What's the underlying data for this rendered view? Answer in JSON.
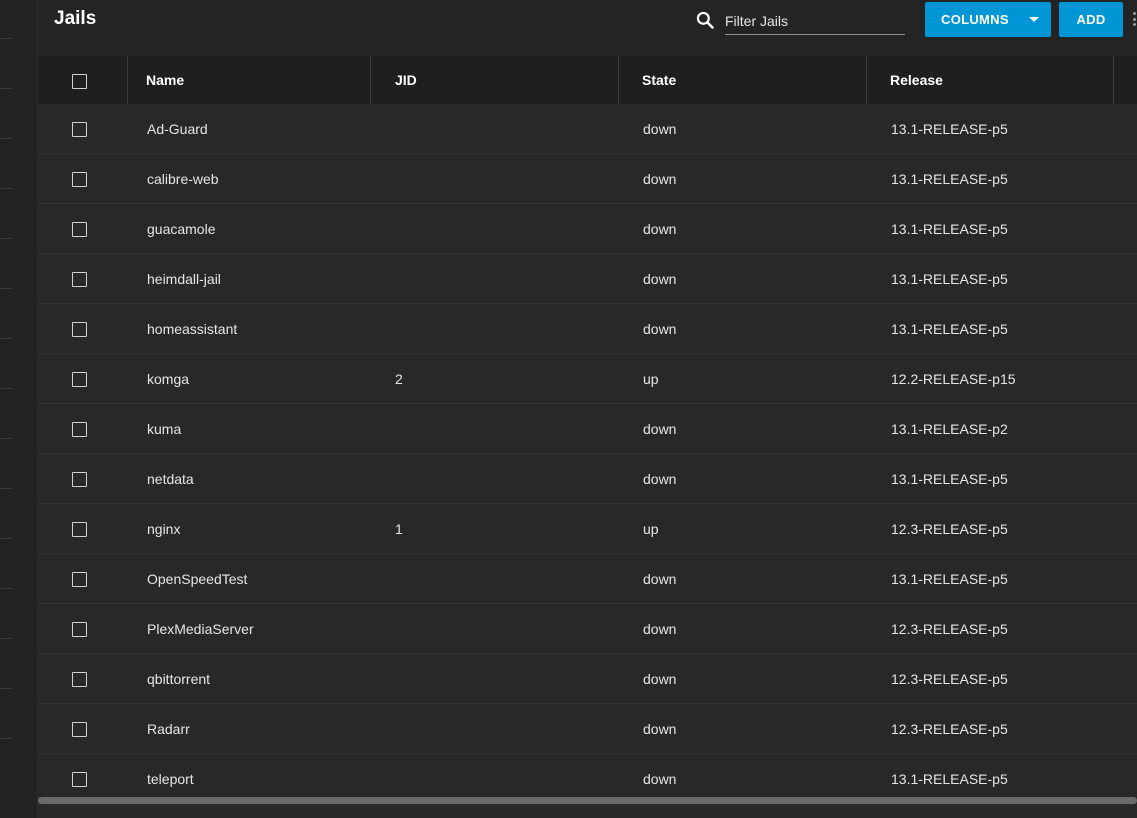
{
  "header": {
    "title": "Jails",
    "search_placeholder": "Filter Jails",
    "search_value": "",
    "columns_label": "COLUMNS",
    "add_label": "ADD"
  },
  "table": {
    "columns": [
      "Name",
      "JID",
      "State",
      "Release"
    ],
    "rows": [
      {
        "name": "Ad-Guard",
        "jid": "",
        "state": "down",
        "release": "13.1-RELEASE-p5"
      },
      {
        "name": "calibre-web",
        "jid": "",
        "state": "down",
        "release": "13.1-RELEASE-p5"
      },
      {
        "name": "guacamole",
        "jid": "",
        "state": "down",
        "release": "13.1-RELEASE-p5"
      },
      {
        "name": "heimdall-jail",
        "jid": "",
        "state": "down",
        "release": "13.1-RELEASE-p5"
      },
      {
        "name": "homeassistant",
        "jid": "",
        "state": "down",
        "release": "13.1-RELEASE-p5"
      },
      {
        "name": "komga",
        "jid": "2",
        "state": "up",
        "release": "12.2-RELEASE-p15"
      },
      {
        "name": "kuma",
        "jid": "",
        "state": "down",
        "release": "13.1-RELEASE-p2"
      },
      {
        "name": "netdata",
        "jid": "",
        "state": "down",
        "release": "13.1-RELEASE-p5"
      },
      {
        "name": "nginx",
        "jid": "1",
        "state": "up",
        "release": "12.3-RELEASE-p5"
      },
      {
        "name": "OpenSpeedTest",
        "jid": "",
        "state": "down",
        "release": "13.1-RELEASE-p5"
      },
      {
        "name": "PlexMediaServer",
        "jid": "",
        "state": "down",
        "release": "12.3-RELEASE-p5"
      },
      {
        "name": "qbittorrent",
        "jid": "",
        "state": "down",
        "release": "12.3-RELEASE-p5"
      },
      {
        "name": "Radarr",
        "jid": "",
        "state": "down",
        "release": "12.3-RELEASE-p5"
      },
      {
        "name": "teleport",
        "jid": "",
        "state": "down",
        "release": "13.1-RELEASE-p5"
      }
    ]
  },
  "colors": {
    "accent": "#0095d5",
    "background": "#282828",
    "header_background": "#1f1f1f"
  }
}
